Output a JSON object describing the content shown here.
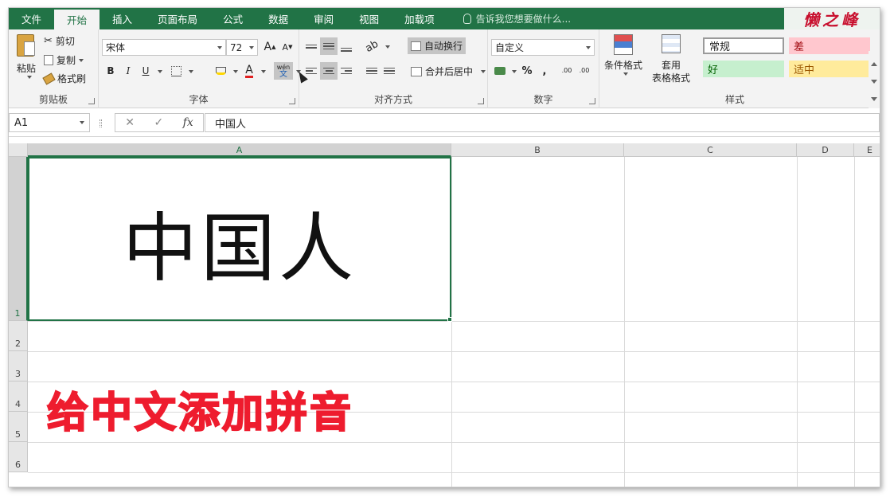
{
  "tabs": [
    "文件",
    "开始",
    "插入",
    "页面布局",
    "公式",
    "数据",
    "审阅",
    "视图",
    "加载项"
  ],
  "active_tab": "开始",
  "tell_me_placeholder": "告诉我您想要做什么...",
  "logo_text": "懒之峰",
  "clipboard": {
    "paste": "粘贴",
    "cut": "剪切",
    "copy": "复制",
    "format_painter": "格式刷",
    "label": "剪贴板"
  },
  "font": {
    "name": "宋体",
    "size": "72",
    "grow": "A",
    "shrink": "A",
    "bold": "B",
    "italic": "I",
    "underline": "U",
    "font_color_glyph": "A",
    "phonetic_top": "wén",
    "phonetic_bottom": "文",
    "label": "字体"
  },
  "alignment": {
    "wrap_text": "自动换行",
    "merge_center": "合并后居中",
    "label": "对齐方式"
  },
  "number": {
    "format": "自定义",
    "percent": "%",
    "comma": ",",
    "inc_decimal": ".00",
    "dec_decimal": ".00",
    "label": "数字"
  },
  "styles": {
    "conditional": "条件格式",
    "table_line1": "套用",
    "table_line2": "表格格式",
    "normal": "常规",
    "bad": "差",
    "good": "好",
    "neutral": "适中",
    "label": "样式"
  },
  "formula_bar": {
    "name_box": "A1",
    "cancel": "✕",
    "enter": "✓",
    "fx": "fx",
    "content": "中国人"
  },
  "columns": [
    "A",
    "B",
    "C",
    "D",
    "E"
  ],
  "rows": [
    "1",
    "2",
    "3",
    "4",
    "5",
    "6"
  ],
  "cell_a1": "中国人",
  "overlay_title": "给中文添加拼音",
  "colors": {
    "excel_green": "#217346",
    "bad_bg": "#ffc7ce",
    "bad_fg": "#9c0006",
    "good_bg": "#c6efce",
    "good_fg": "#006100",
    "neutral_bg": "#ffeb9c",
    "neutral_fg": "#9c5700",
    "overlay_red": "#ee1c2e"
  }
}
